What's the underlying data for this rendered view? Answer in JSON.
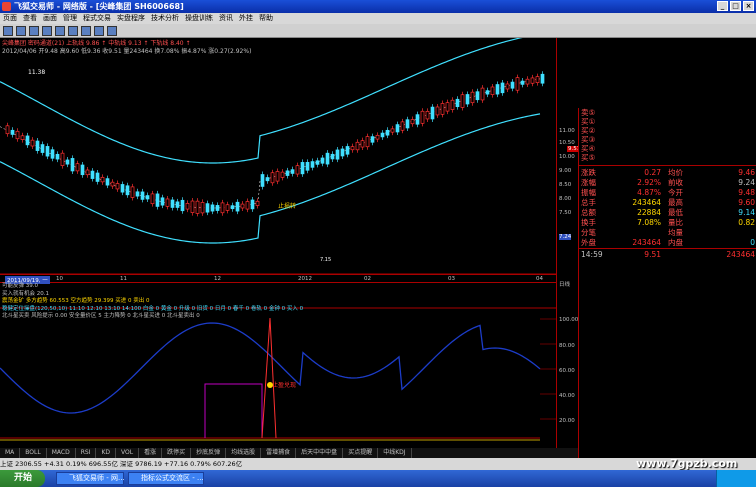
{
  "window": {
    "title": "飞狐交易师 - 网络版 - [尖峰集团 SH600668]"
  },
  "menu": [
    "页面",
    "查看",
    "画面",
    "管理",
    "程式交易",
    "实盘程序",
    "技术分析",
    "操盘训练",
    "资讯",
    "外挂",
    "帮助"
  ],
  "chart_info": {
    "line1": "尖峰集团 密码通道(21) 上轨线 9.86 ↑ 中轨线 9.13 ↑ 下轨线 8.40 ↑",
    "line2": "2012/04/06 开9.48 高9.60 低9.36 收9.51 量243464 换7.08% 振4.87% 涨0.27(2.92%)"
  },
  "chart_labels": {
    "hi": "11.38",
    "lo": "7.15",
    "warn": "止损转",
    "sell": "止盈兑现"
  },
  "xaxis": [
    "2011/09/19, 一",
    "10",
    "11",
    "12",
    "2012",
    "02",
    "03",
    "04"
  ],
  "yaxis": [
    "11.00",
    "10.50",
    "10.00",
    "9.50",
    "9.00",
    "8.50",
    "8.00",
    "7.50",
    "7.24"
  ],
  "lower_titles": [
    "可能反弹  39.0",
    "买入就有机会  20.1",
    "震荡金矿  多方趋势 60.553 空方趋势 29.399 买进 0  卖出 0",
    "稳健定位操盘(120,50,10) 11:10 12:10 13:10 14:100 白金 0 黄金 0 升级 0 旧货 0 日月 0 春千 0 卷轨 0 金钟 0 买入 0",
    "北斗星买卖  风险提示 0.00  安全量价区 5  主力降势 0  北斗星买进 0  北斗星卖出 0"
  ],
  "indicator_scale": [
    "100.00",
    "80.00",
    "60.00",
    "40.00",
    "20.00"
  ],
  "quote": {
    "top_rows": [
      {
        "k": "卖⑤",
        "v": ""
      },
      {
        "k": "买①",
        "v": ""
      },
      {
        "k": "买②",
        "v": ""
      },
      {
        "k": "买③",
        "v": ""
      },
      {
        "k": "买④",
        "v": ""
      },
      {
        "k": "买⑤",
        "v": ""
      }
    ],
    "rows": [
      {
        "k": "涨跌",
        "v1": "0.27",
        "k2": "均价",
        "v2": "9.46"
      },
      {
        "k": "涨幅",
        "v1": "2.92%",
        "k2": "前收",
        "v2": "9.24"
      },
      {
        "k": "振幅",
        "v1": "4.87%",
        "k2": "今开",
        "v2": "9.48"
      },
      {
        "k": "总手",
        "v1": "243464",
        "k2": "最高",
        "v2": "9.60"
      },
      {
        "k": "总额",
        "v1": "22884",
        "k2": "最低",
        "v2": "9.14"
      },
      {
        "k": "换手",
        "v1": "7.08%",
        "k2": "量比",
        "v2": "0.82"
      },
      {
        "k": "分笔",
        "v1": "",
        "k2": "均量",
        "v2": ""
      },
      {
        "k": "外盘",
        "v1": "243464",
        "k2": "内盘",
        "v2": "0"
      }
    ],
    "trade_time": "14:59",
    "trade_price": "9.51",
    "trade_vol": "243464"
  },
  "price_tag": "9.51",
  "tabs": [
    "MA",
    "BOLL",
    "MACD",
    "RSI",
    "KD",
    "VOL",
    "看涨",
    "跌停买",
    "抄底反弹",
    "均线选股",
    "雷增捕食",
    "后天中中中盘",
    "买点提醒",
    "中线KDJ"
  ],
  "status": "上证 2306.55 +4.31 0.19% 696.55亿   深证 9786.19 +77.16 0.79% 607.26亿",
  "taskbar": {
    "start": "开始",
    "task1": "飞狐交易师 - 网...",
    "task2": "指标公式交流区 - ..."
  },
  "watermark": "www.7gpzb.com",
  "colors": {
    "up": "#ff3030",
    "down": "#40e0ff",
    "channel_up": "#ff3030",
    "channel_mid": "#40e0ff",
    "indicator": "#1c3cc8",
    "accent": "#c000c0"
  }
}
